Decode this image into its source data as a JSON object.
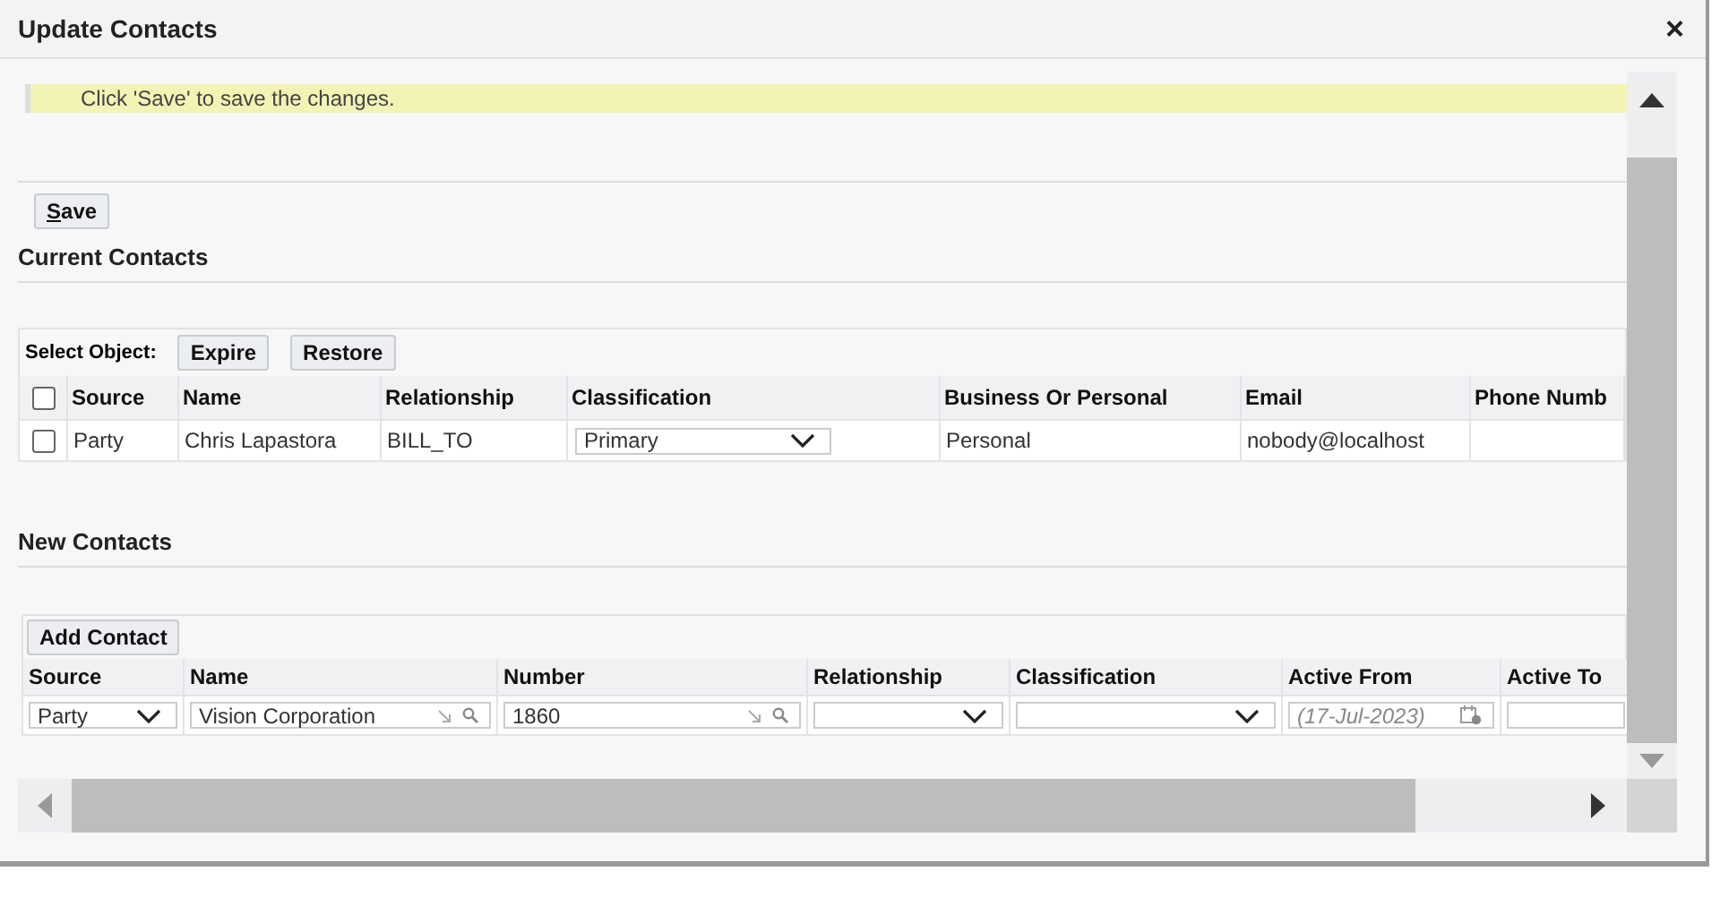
{
  "window": {
    "title": "Update Contacts",
    "close": "×"
  },
  "message": "Click 'Save' to save the changes.",
  "save_button": "Save",
  "current_contacts": {
    "title": "Current Contacts",
    "select_label": "Select Object:",
    "buttons": [
      "Expire",
      "Restore"
    ],
    "select_all_checked": false,
    "columns": [
      "Source",
      "Name",
      "Relationship",
      "Classification",
      "Business Or Personal",
      "Email",
      "Phone Numb"
    ],
    "rows": [
      {
        "checked": false,
        "source": "Party",
        "name": "Chris Lapastora",
        "relationship": "BILL_TO",
        "classification": "Primary",
        "business_or_personal": "Personal",
        "email": "nobody@localhost"
      }
    ]
  },
  "new_contacts": {
    "title": "New Contacts",
    "button": "Add Contact",
    "columns": [
      "Source",
      "Name",
      "Number",
      "Relationship",
      "Classification",
      "Active From",
      "Active To"
    ],
    "fields": [
      {
        "kind": "select",
        "value": "Party"
      },
      {
        "kind": "lookup",
        "value": "Vision Corporation"
      },
      {
        "kind": "lookup",
        "value": "1860"
      },
      {
        "kind": "select"
      },
      {
        "kind": "select"
      },
      {
        "kind": "date",
        "placeholder": "(17-Jul-2023)"
      },
      {
        "kind": "text"
      }
    ]
  }
}
